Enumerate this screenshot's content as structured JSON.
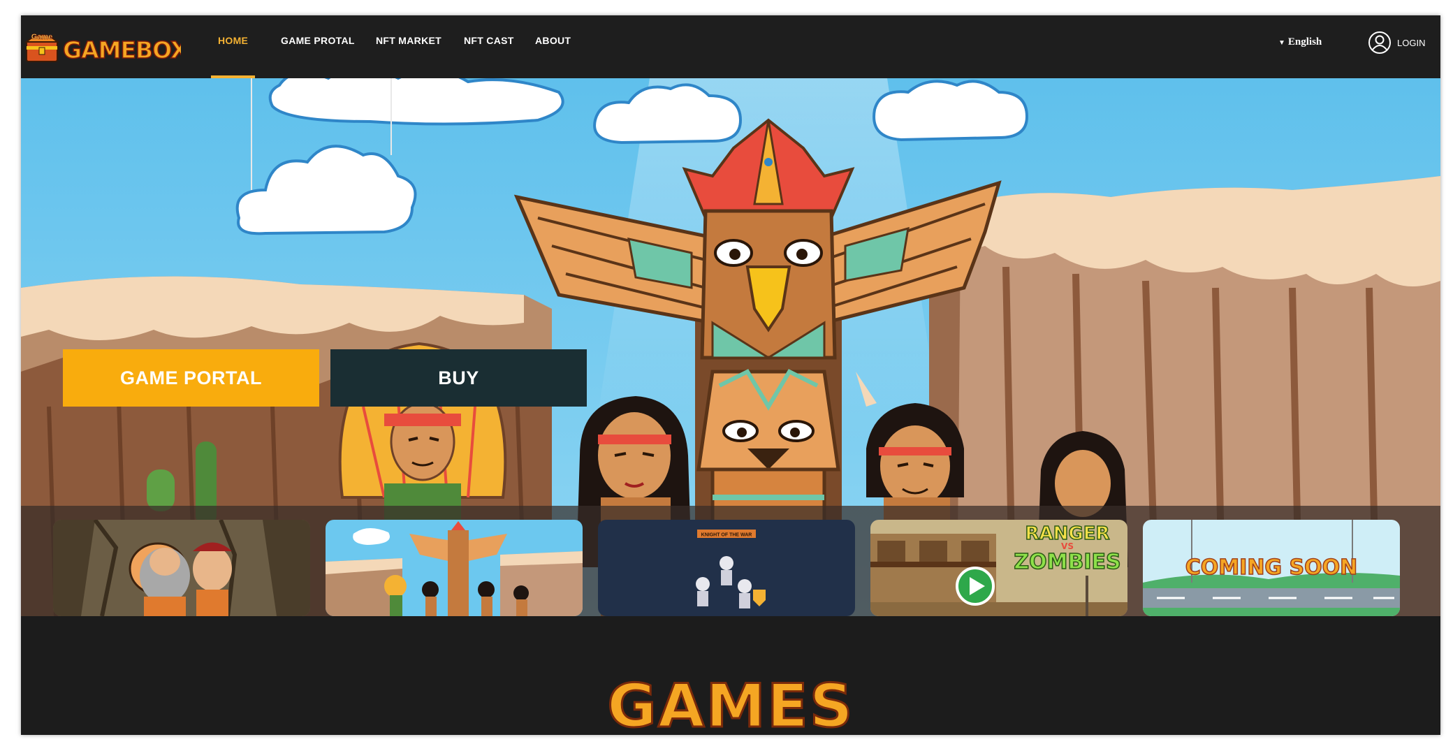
{
  "brand": {
    "logo_badge": "Game",
    "logo_text": "GAMEBOX"
  },
  "nav": {
    "items": [
      {
        "label": "HOME",
        "active": true
      },
      {
        "label": "GAME PROTAL",
        "active": false
      },
      {
        "label": "NFT MARKET",
        "active": false
      },
      {
        "label": "NFT CAST",
        "active": false
      },
      {
        "label": "ABOUT",
        "active": false
      }
    ],
    "language": "English",
    "language_icon": "caret-down-icon",
    "login_label": "LOGIN",
    "login_icon": "user-circle-icon"
  },
  "hero": {
    "portal_button": "GAME PORTAL",
    "buy_button": "BUY"
  },
  "thumbnails": [
    {
      "name": "caveman-game",
      "title": ""
    },
    {
      "name": "totem-game",
      "title": ""
    },
    {
      "name": "knight-game",
      "title": "KNIGHT OF THE WAR"
    },
    {
      "name": "ranger-vs-zombies",
      "title": "RANGER",
      "subtitle": "VS",
      "title2": "ZOMBIES"
    },
    {
      "name": "coming-soon",
      "title": "COMING SOON"
    }
  ],
  "section": {
    "games_title": "GAMES"
  },
  "colors": {
    "accent": "#f4b233",
    "portal_button": "#f9ac0d",
    "buy_button": "#1a2e33",
    "nav_bg": "#1e1e1e",
    "sky": "#6cc8ef"
  }
}
